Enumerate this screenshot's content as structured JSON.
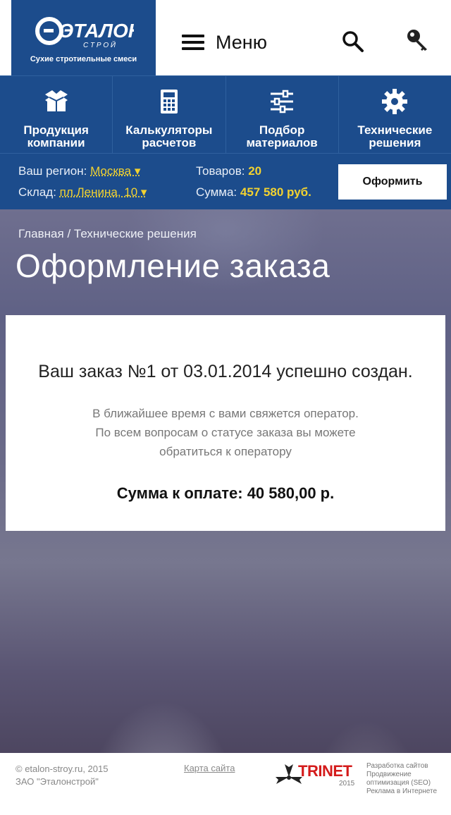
{
  "header": {
    "logo_brand": "ЭТАЛОН",
    "logo_brand_sub": "С Т Р О Й",
    "logo_tagline": "Сухие стротиельные смеси",
    "menu_label": "Меню",
    "search_icon": "search-icon",
    "login_icon": "key-icon"
  },
  "categories": [
    {
      "label": "Продукция компании",
      "icon": "box-icon"
    },
    {
      "label": "Калькуляторы расчетов",
      "icon": "calculator-icon"
    },
    {
      "label": "Подбор материалов",
      "icon": "sliders-icon"
    },
    {
      "label": "Технические решения",
      "icon": "gear-icon"
    }
  ],
  "cart": {
    "region_label": "Ваш регион:",
    "region_value": "Москва ▾",
    "warehouse_label": "Склад:",
    "warehouse_value": "пл.Ленина, 10 ▾",
    "items_label": "Товаров:",
    "items_value": "20",
    "sum_label": "Сумма:",
    "sum_value": "457 580 руб.",
    "checkout_label": "Оформить"
  },
  "breadcrumb": {
    "home": "Главная",
    "separator": "/",
    "current": "Технические решения"
  },
  "page_title": "Оформление заказа",
  "order": {
    "title": "Ваш заказ №1 от 03.01.2014 успешно создан.",
    "message_line1": "В ближайшее время с вами свяжется оператор.",
    "message_line2": "По всем вопросам о статусе заказа вы можете",
    "message_line3": "обратиться к оператору",
    "sum_text": "Сумма к оплате: 40 580,00 р."
  },
  "footer": {
    "copyright": "© etalon-stroy.ru, 2015",
    "company": "ЗАО \"Эталонстрой\"",
    "sitemap": "Карта сайта",
    "developer_name": "TRINET",
    "developer_year": "2015",
    "services": [
      "Разработка сайтов",
      "Продвижение",
      "оптимизация (SEO)",
      "Реклама в Интернете"
    ]
  },
  "colors": {
    "brand_blue": "#1c4c8c",
    "accent_yellow": "#f2d230",
    "developer_red": "#d41b1b"
  }
}
